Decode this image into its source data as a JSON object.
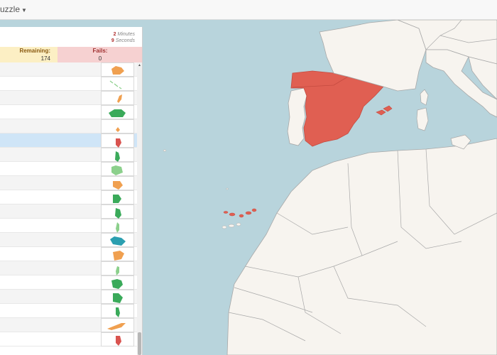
{
  "navbar": {
    "label": "uzzle",
    "caret": "▼"
  },
  "timer": {
    "minutes_value": "2",
    "minutes_label": "Minutes",
    "seconds_value": "9",
    "seconds_label": "Seconds"
  },
  "stats": {
    "remaining_label": "Remaining:",
    "remaining_value": "174",
    "fails_label": "Fails:",
    "fails_value": "0"
  },
  "list": {
    "rows": [
      {
        "color": "#f0a050"
      },
      {
        "color": "#8cd08c"
      },
      {
        "color": "#f0a050"
      },
      {
        "color": "#3aaa5a"
      },
      {
        "color": "#f0a050"
      },
      {
        "color": "#d9534f"
      },
      {
        "color": "#3aaa5a"
      },
      {
        "color": "#8cd08c"
      },
      {
        "color": "#f0a050"
      },
      {
        "color": "#3aaa5a"
      },
      {
        "color": "#3aaa5a"
      },
      {
        "color": "#8cd08c"
      },
      {
        "color": "#2b9fb0"
      },
      {
        "color": "#f0a050"
      },
      {
        "color": "#8cd08c"
      },
      {
        "color": "#3aaa5a"
      },
      {
        "color": "#3aaa5a"
      },
      {
        "color": "#3aaa5a"
      },
      {
        "color": "#f0a050"
      },
      {
        "color": "#d9534f"
      }
    ],
    "selected_index": 5
  },
  "map": {
    "colors": {
      "sea": "#b8d4dc",
      "land": "#f7f4ef",
      "border": "#a8a8a8",
      "highlight": "#e05f52"
    }
  }
}
